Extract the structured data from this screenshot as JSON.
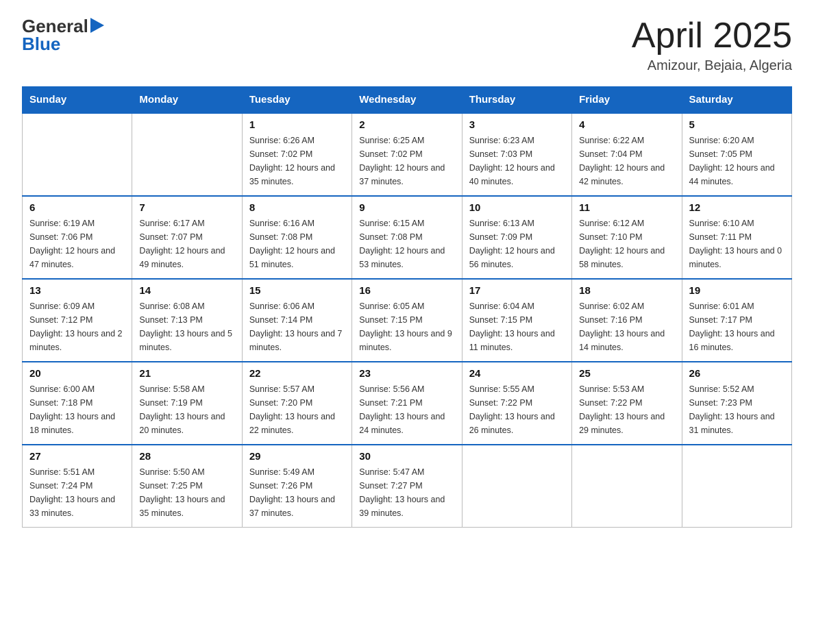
{
  "header": {
    "logo": {
      "general": "General",
      "arrow": "▶",
      "blue": "Blue"
    },
    "title": "April 2025",
    "subtitle": "Amizour, Bejaia, Algeria"
  },
  "days_of_week": [
    "Sunday",
    "Monday",
    "Tuesday",
    "Wednesday",
    "Thursday",
    "Friday",
    "Saturday"
  ],
  "weeks": [
    [
      {
        "day": "",
        "sunrise": "",
        "sunset": "",
        "daylight": ""
      },
      {
        "day": "",
        "sunrise": "",
        "sunset": "",
        "daylight": ""
      },
      {
        "day": "1",
        "sunrise": "Sunrise: 6:26 AM",
        "sunset": "Sunset: 7:02 PM",
        "daylight": "Daylight: 12 hours and 35 minutes."
      },
      {
        "day": "2",
        "sunrise": "Sunrise: 6:25 AM",
        "sunset": "Sunset: 7:02 PM",
        "daylight": "Daylight: 12 hours and 37 minutes."
      },
      {
        "day": "3",
        "sunrise": "Sunrise: 6:23 AM",
        "sunset": "Sunset: 7:03 PM",
        "daylight": "Daylight: 12 hours and 40 minutes."
      },
      {
        "day": "4",
        "sunrise": "Sunrise: 6:22 AM",
        "sunset": "Sunset: 7:04 PM",
        "daylight": "Daylight: 12 hours and 42 minutes."
      },
      {
        "day": "5",
        "sunrise": "Sunrise: 6:20 AM",
        "sunset": "Sunset: 7:05 PM",
        "daylight": "Daylight: 12 hours and 44 minutes."
      }
    ],
    [
      {
        "day": "6",
        "sunrise": "Sunrise: 6:19 AM",
        "sunset": "Sunset: 7:06 PM",
        "daylight": "Daylight: 12 hours and 47 minutes."
      },
      {
        "day": "7",
        "sunrise": "Sunrise: 6:17 AM",
        "sunset": "Sunset: 7:07 PM",
        "daylight": "Daylight: 12 hours and 49 minutes."
      },
      {
        "day": "8",
        "sunrise": "Sunrise: 6:16 AM",
        "sunset": "Sunset: 7:08 PM",
        "daylight": "Daylight: 12 hours and 51 minutes."
      },
      {
        "day": "9",
        "sunrise": "Sunrise: 6:15 AM",
        "sunset": "Sunset: 7:08 PM",
        "daylight": "Daylight: 12 hours and 53 minutes."
      },
      {
        "day": "10",
        "sunrise": "Sunrise: 6:13 AM",
        "sunset": "Sunset: 7:09 PM",
        "daylight": "Daylight: 12 hours and 56 minutes."
      },
      {
        "day": "11",
        "sunrise": "Sunrise: 6:12 AM",
        "sunset": "Sunset: 7:10 PM",
        "daylight": "Daylight: 12 hours and 58 minutes."
      },
      {
        "day": "12",
        "sunrise": "Sunrise: 6:10 AM",
        "sunset": "Sunset: 7:11 PM",
        "daylight": "Daylight: 13 hours and 0 minutes."
      }
    ],
    [
      {
        "day": "13",
        "sunrise": "Sunrise: 6:09 AM",
        "sunset": "Sunset: 7:12 PM",
        "daylight": "Daylight: 13 hours and 2 minutes."
      },
      {
        "day": "14",
        "sunrise": "Sunrise: 6:08 AM",
        "sunset": "Sunset: 7:13 PM",
        "daylight": "Daylight: 13 hours and 5 minutes."
      },
      {
        "day": "15",
        "sunrise": "Sunrise: 6:06 AM",
        "sunset": "Sunset: 7:14 PM",
        "daylight": "Daylight: 13 hours and 7 minutes."
      },
      {
        "day": "16",
        "sunrise": "Sunrise: 6:05 AM",
        "sunset": "Sunset: 7:15 PM",
        "daylight": "Daylight: 13 hours and 9 minutes."
      },
      {
        "day": "17",
        "sunrise": "Sunrise: 6:04 AM",
        "sunset": "Sunset: 7:15 PM",
        "daylight": "Daylight: 13 hours and 11 minutes."
      },
      {
        "day": "18",
        "sunrise": "Sunrise: 6:02 AM",
        "sunset": "Sunset: 7:16 PM",
        "daylight": "Daylight: 13 hours and 14 minutes."
      },
      {
        "day": "19",
        "sunrise": "Sunrise: 6:01 AM",
        "sunset": "Sunset: 7:17 PM",
        "daylight": "Daylight: 13 hours and 16 minutes."
      }
    ],
    [
      {
        "day": "20",
        "sunrise": "Sunrise: 6:00 AM",
        "sunset": "Sunset: 7:18 PM",
        "daylight": "Daylight: 13 hours and 18 minutes."
      },
      {
        "day": "21",
        "sunrise": "Sunrise: 5:58 AM",
        "sunset": "Sunset: 7:19 PM",
        "daylight": "Daylight: 13 hours and 20 minutes."
      },
      {
        "day": "22",
        "sunrise": "Sunrise: 5:57 AM",
        "sunset": "Sunset: 7:20 PM",
        "daylight": "Daylight: 13 hours and 22 minutes."
      },
      {
        "day": "23",
        "sunrise": "Sunrise: 5:56 AM",
        "sunset": "Sunset: 7:21 PM",
        "daylight": "Daylight: 13 hours and 24 minutes."
      },
      {
        "day": "24",
        "sunrise": "Sunrise: 5:55 AM",
        "sunset": "Sunset: 7:22 PM",
        "daylight": "Daylight: 13 hours and 26 minutes."
      },
      {
        "day": "25",
        "sunrise": "Sunrise: 5:53 AM",
        "sunset": "Sunset: 7:22 PM",
        "daylight": "Daylight: 13 hours and 29 minutes."
      },
      {
        "day": "26",
        "sunrise": "Sunrise: 5:52 AM",
        "sunset": "Sunset: 7:23 PM",
        "daylight": "Daylight: 13 hours and 31 minutes."
      }
    ],
    [
      {
        "day": "27",
        "sunrise": "Sunrise: 5:51 AM",
        "sunset": "Sunset: 7:24 PM",
        "daylight": "Daylight: 13 hours and 33 minutes."
      },
      {
        "day": "28",
        "sunrise": "Sunrise: 5:50 AM",
        "sunset": "Sunset: 7:25 PM",
        "daylight": "Daylight: 13 hours and 35 minutes."
      },
      {
        "day": "29",
        "sunrise": "Sunrise: 5:49 AM",
        "sunset": "Sunset: 7:26 PM",
        "daylight": "Daylight: 13 hours and 37 minutes."
      },
      {
        "day": "30",
        "sunrise": "Sunrise: 5:47 AM",
        "sunset": "Sunset: 7:27 PM",
        "daylight": "Daylight: 13 hours and 39 minutes."
      },
      {
        "day": "",
        "sunrise": "",
        "sunset": "",
        "daylight": ""
      },
      {
        "day": "",
        "sunrise": "",
        "sunset": "",
        "daylight": ""
      },
      {
        "day": "",
        "sunrise": "",
        "sunset": "",
        "daylight": ""
      }
    ]
  ]
}
